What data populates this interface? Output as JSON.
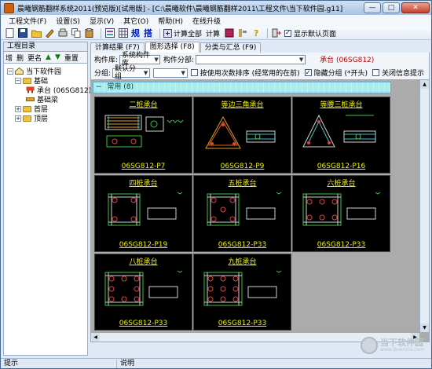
{
  "window": {
    "title": "晨曦钢筋翻样系统2011(预览版)[试用版] - [C:\\晨曦软件\\晨曦钢筋翻样2011\\工程文件\\当下软件园.g11]",
    "min_label": "—",
    "max_label": "□",
    "close_label": "✕"
  },
  "menu": [
    {
      "label": "工程文件(F)"
    },
    {
      "label": "设置(S)"
    },
    {
      "label": "显示(V)"
    },
    {
      "label": "其它(O)"
    },
    {
      "label": "帮助(H)"
    },
    {
      "label": "在线升级"
    }
  ],
  "toolbar": {
    "rules_label": "规",
    "pick_label": "搭",
    "calc_all_label": "计算全部",
    "calc_label": "计算",
    "show_default_label": "显示默认页面",
    "show_default_checked": "✓"
  },
  "left_panel": {
    "title": "工程目录",
    "buttons": [
      {
        "label": "增"
      },
      {
        "label": "删"
      },
      {
        "label": "更名"
      },
      {
        "label": "▲"
      },
      {
        "label": "▼"
      },
      {
        "label": "重置"
      }
    ],
    "tree": [
      {
        "label": "当下软件园",
        "expander": "−"
      },
      {
        "label": "基础",
        "expander": "−"
      },
      {
        "label": "承台 (06SG812)"
      },
      {
        "label": "基础梁"
      },
      {
        "label": "首层",
        "expander": "+"
      },
      {
        "label": "顶层",
        "expander": "+"
      }
    ]
  },
  "tabs": [
    {
      "label": "计算结果 (F7)"
    },
    {
      "label": "图形选择 (F8)"
    },
    {
      "label": "分类与汇总 (F9)"
    }
  ],
  "filters": {
    "component_lib_label": "构件库:",
    "component_lib_value": "系统构件库",
    "component_category_label": "构件分部:",
    "component_category_value": "",
    "badge": "承台 (06SG812)",
    "group_label": "分组:",
    "group_value": "默认分组",
    "second_select_value": "",
    "sort_by_usage_label": "按使用次数排序 (经常用的在前)",
    "hide_group_label": "隐藏分组 (*开头)",
    "close_info_label": "关闭信息提示"
  },
  "group": {
    "expander": "−",
    "name": "常用 (8)"
  },
  "cards": [
    {
      "title": "二桩承台",
      "code": "06SG812-P7"
    },
    {
      "title": "等边三角承台",
      "code": "06SG812-P9"
    },
    {
      "title": "等腰三桩承台",
      "code": "06SG812-P16"
    },
    {
      "title": "四桩承台",
      "code": "06SG812-P19"
    },
    {
      "title": "五桩承台",
      "code": "06SG812-P33"
    },
    {
      "title": "六桩承台",
      "code": "06SG812-P33"
    },
    {
      "title": "八桩承台",
      "code": "06SG812-P33"
    },
    {
      "title": "九桩承台",
      "code": "06SG812-P33"
    }
  ],
  "status": {
    "hint_label": "提示",
    "desc_label": "说明"
  },
  "watermark": {
    "text": "当下软件园",
    "sub": "www.downxia.com"
  },
  "colors": {
    "card_bg": "#000000",
    "card_text": "#f0f000",
    "group_header": "#a8ecec",
    "badge": "#c00000"
  }
}
